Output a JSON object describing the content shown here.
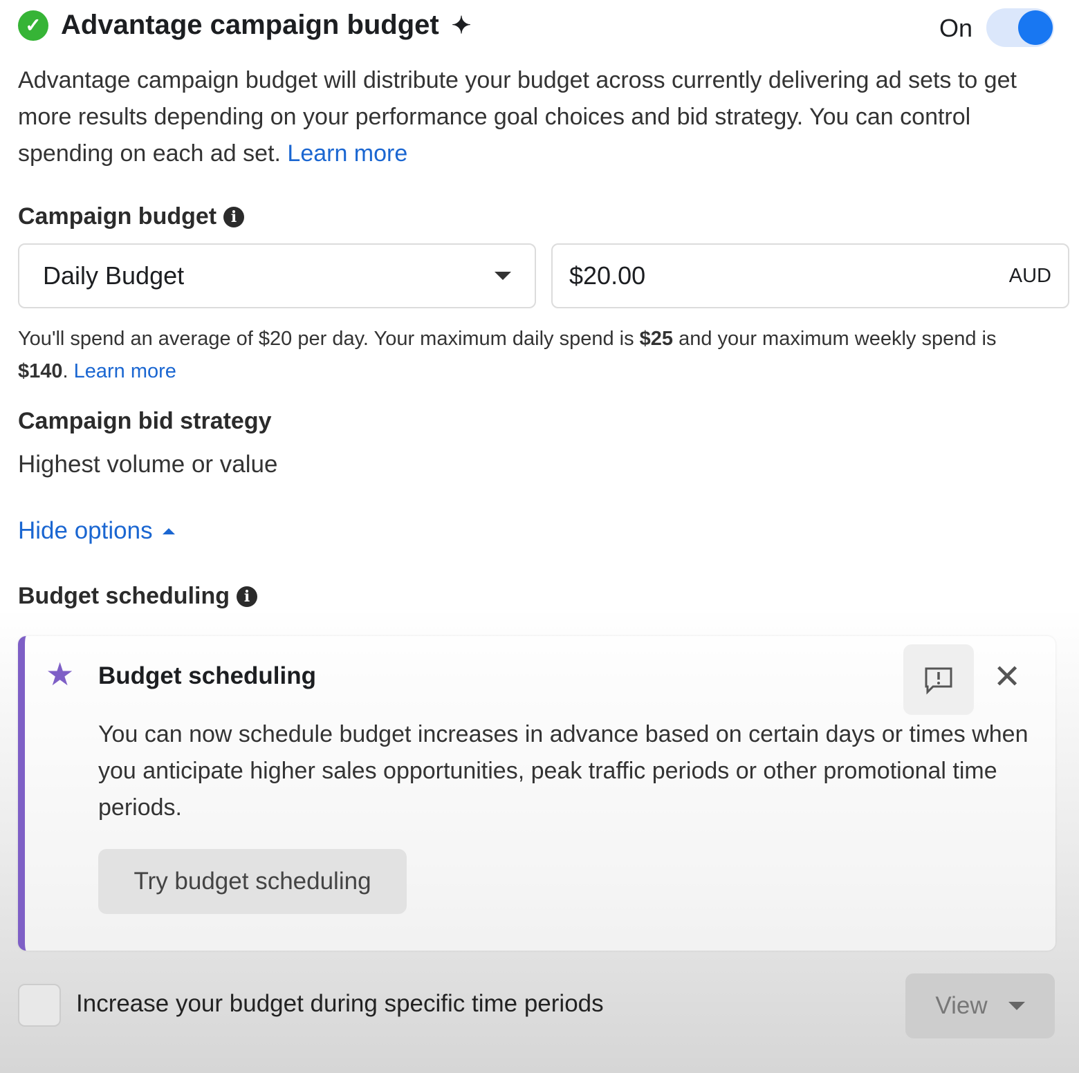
{
  "header": {
    "title": "Advantage campaign budget",
    "sparkle_icon": "sparkle-icon",
    "toggle_label": "On",
    "toggle_on": true,
    "accent": "#1877f2"
  },
  "description": {
    "text": "Advantage campaign budget will distribute your budget across currently delivering ad sets to get more results depending on your performance goal choices and bid strategy. You can control spending on each ad set. ",
    "link": "Learn more"
  },
  "budget": {
    "label": "Campaign budget",
    "type_value": "Daily Budget",
    "amount_value": "$20.00",
    "currency": "AUD",
    "note_1": "You'll spend an average of $20 per day. Your maximum daily spend is ",
    "max_daily": "$25",
    "note_2": " and your maximum weekly spend is ",
    "max_weekly": "$140",
    "note_3": ". ",
    "link": "Learn more"
  },
  "bid": {
    "label": "Campaign bid strategy",
    "value": "Highest volume or value"
  },
  "hide_options": "Hide options",
  "scheduling": {
    "label": "Budget scheduling",
    "card": {
      "title": "Budget scheduling",
      "body": "You can now schedule budget increases in advance based on certain days or times when you anticipate higher sales opportunities, peak traffic periods or other promotional time periods.",
      "button": "Try budget scheduling",
      "accent": "#7e5fc6"
    },
    "checkbox_label": "Increase your budget during specific time periods",
    "checked": false,
    "view_button": "View"
  }
}
